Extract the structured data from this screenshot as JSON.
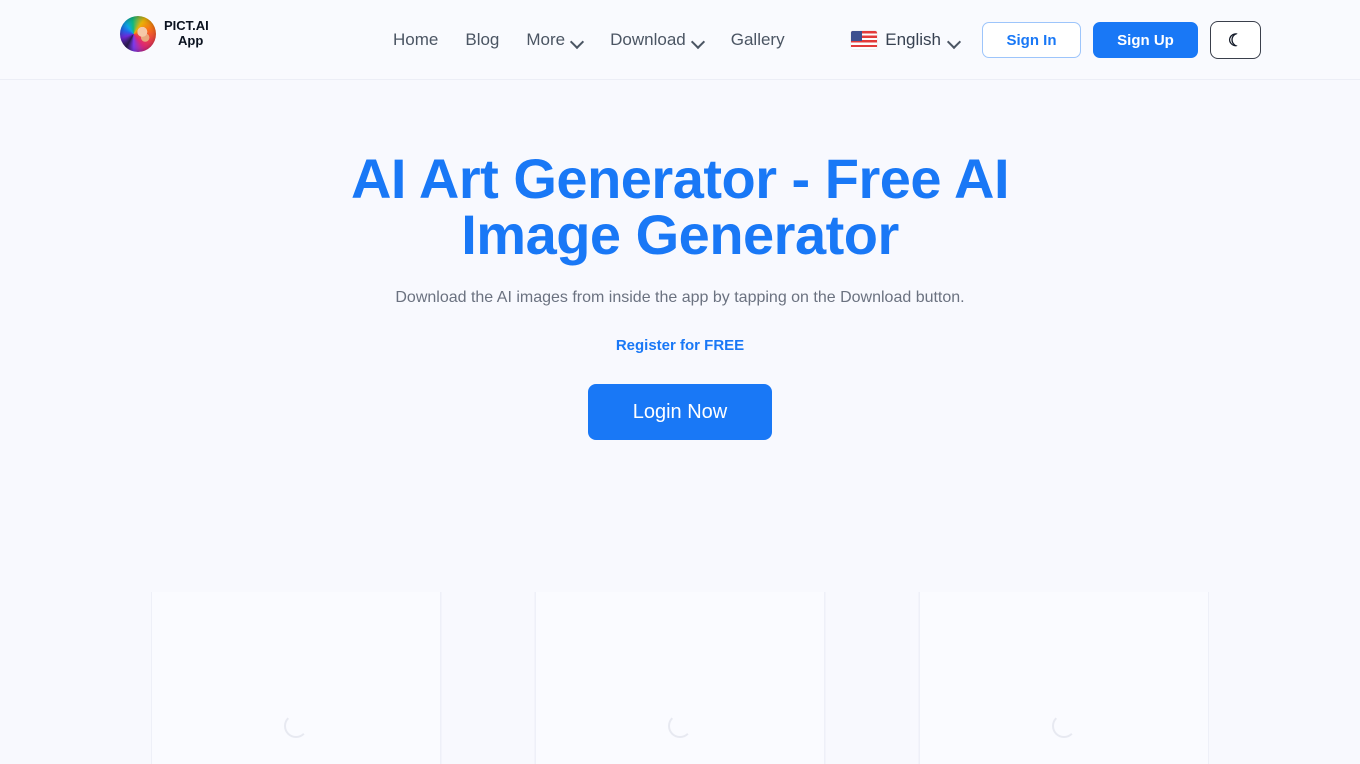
{
  "header": {
    "brand": {
      "logo_icon": "pict-ai-avatar-icon",
      "line1": "PICT.AI",
      "line2": "App"
    },
    "nav": [
      {
        "label": "Home",
        "has_chevron": false
      },
      {
        "label": "Blog",
        "has_chevron": false
      },
      {
        "label": "More",
        "has_chevron": true
      },
      {
        "label": "Download",
        "has_chevron": true
      },
      {
        "label": "Gallery",
        "has_chevron": false
      }
    ],
    "language": {
      "flag_icon": "us-flag-icon",
      "label": "English",
      "chevron_icon": "chevron-down-icon"
    },
    "sign_in_label": "Sign In",
    "sign_up_label": "Sign Up",
    "theme_toggle": {
      "icon": "moon-icon",
      "glyph": "☾"
    }
  },
  "hero": {
    "title": "AI Art Generator - Free AI Image Generator",
    "subtitle": "Download the AI images from inside the app by tapping on the Download button.",
    "register_link": "Register for FREE",
    "login_button": "Login Now"
  },
  "gallery": {
    "status": "loading",
    "spinner_icon": "loading-spinner-icon",
    "columns": 5
  },
  "colors": {
    "accent": "#1978f6",
    "page_background": "#f8f9fe",
    "header_background": "#f9fafe",
    "body_text": "#4b5563",
    "muted_text": "#6b7280",
    "border": "#eceef6"
  }
}
